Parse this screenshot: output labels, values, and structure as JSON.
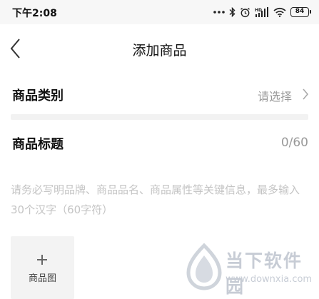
{
  "status_bar": {
    "time": "下午2:08",
    "battery": "84",
    "icons": [
      "more-dots-icon",
      "bluetooth-icon",
      "alarm-icon",
      "hd-signal-icon",
      "wifi-icon",
      "battery-icon"
    ]
  },
  "nav": {
    "title": "添加商品",
    "back_icon": "chevron-left-icon"
  },
  "category": {
    "label": "商品类别",
    "value": "请选择"
  },
  "title_field": {
    "label": "商品标题",
    "count": "0/60",
    "placeholder": "请务必写明品牌、商品品名、商品属性等关键信息，最多输入30个汉字（60字符）"
  },
  "image_upload": {
    "label": "商品图"
  },
  "watermark": {
    "name": "当下软件园",
    "url": "www.downxia.com"
  },
  "colors": {
    "status_bar_bg": "#f7f7f7",
    "divider": "#f2f2f2",
    "muted_text": "#999999",
    "placeholder": "#c4c4c4"
  }
}
